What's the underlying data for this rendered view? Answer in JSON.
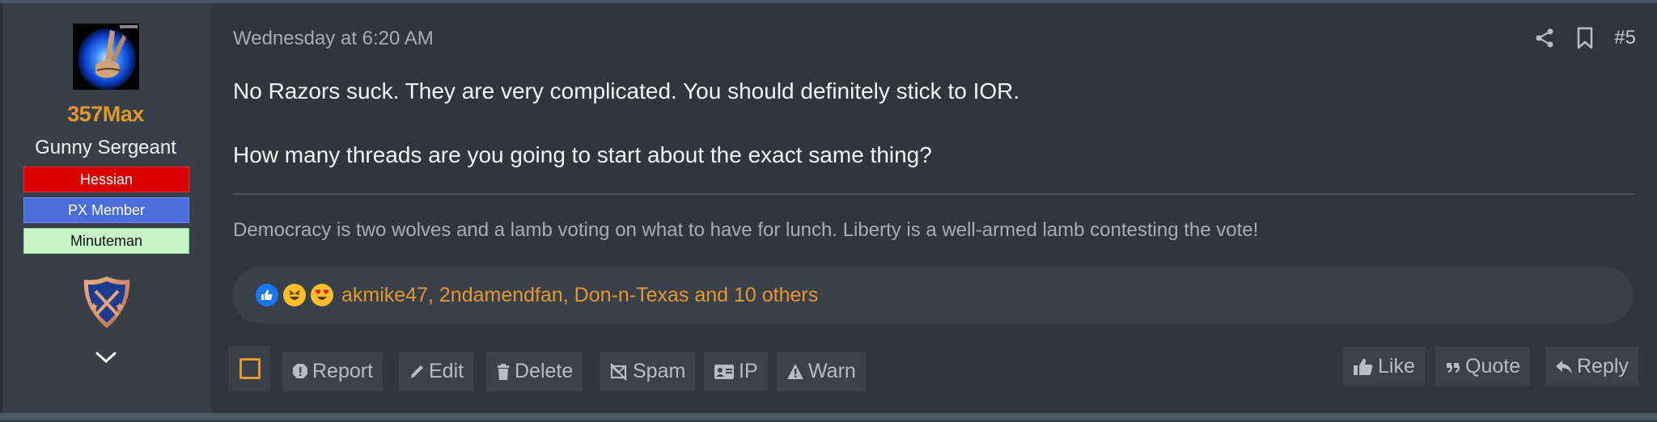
{
  "author": {
    "username": "357Max",
    "title": "Gunny Sergeant",
    "banners": [
      "Hessian",
      "PX Member",
      "Minuteman"
    ],
    "avatar_icon": "avatar-coyote-image",
    "badge_icon": "crossed-rifles-shield-icon",
    "expand_icon": "chevron-down-icon"
  },
  "post": {
    "timestamp": "Wednesday at 6:20 AM",
    "number": "#5",
    "share_icon": "share-icon",
    "bookmark_icon": "bookmark-icon",
    "message_lines": [
      "No Razors suck. They are very complicated. You should definitely stick to IOR.",
      "How many threads are you going to start about the exact same thing?"
    ],
    "signature": "Democracy is two wolves and a lamb voting on what to have for lunch. Liberty is a well-armed lamb contesting the vote!"
  },
  "reactions": {
    "icons": [
      "like-reaction-icon",
      "haha-reaction-icon",
      "love-reaction-icon"
    ],
    "summary": "akmike47, 2ndamendfan, Don-n-Texas and 10 others"
  },
  "actions": {
    "left": [
      {
        "label": "Report",
        "icon": "report-icon"
      },
      {
        "label": "Edit",
        "icon": "pencil-icon"
      },
      {
        "label": "Delete",
        "icon": "trash-icon"
      },
      {
        "label": "Spam",
        "icon": "spam-icon"
      },
      {
        "label": "IP",
        "icon": "id-card-icon"
      },
      {
        "label": "Warn",
        "icon": "warning-icon"
      }
    ],
    "right": [
      {
        "label": "Like",
        "icon": "thumbs-up-icon"
      },
      {
        "label": "Quote",
        "icon": "quote-icon"
      },
      {
        "label": "Reply",
        "icon": "reply-icon"
      }
    ]
  },
  "colors": {
    "accent": "#e2992d",
    "background": "#31353d",
    "sidebar": "#393f48",
    "hessian": "#d90000",
    "px_member": "#4a6ddb",
    "minuteman": "#c8f5c8"
  }
}
